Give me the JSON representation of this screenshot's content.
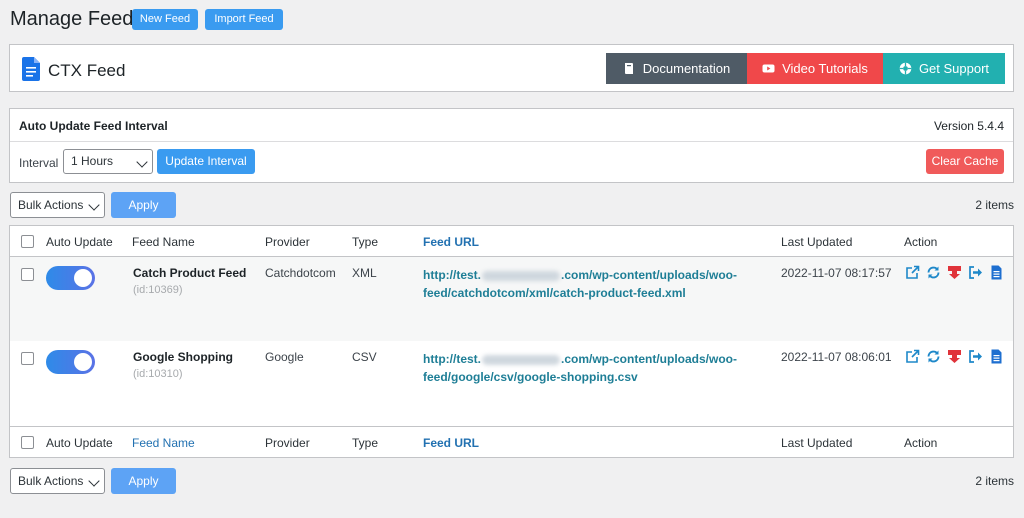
{
  "header": {
    "title": "Manage Feed",
    "new_feed": "New Feed",
    "import_feed": "Import Feed"
  },
  "brand": {
    "name": "CTX Feed",
    "documentation": "Documentation",
    "video_tutorials": "Video Tutorials",
    "get_support": "Get Support",
    "colors": {
      "documentation": "#4f5b66",
      "video": "#f0484a",
      "support": "#22b0b0"
    }
  },
  "auto_update": {
    "title": "Auto Update Feed Interval",
    "version": "Version 5.4.4",
    "interval_label": "Interval",
    "interval_value": "1 Hours",
    "update_button": "Update Interval",
    "clear_cache": "Clear Cache"
  },
  "bulk": {
    "select_value": "Bulk Actions",
    "apply": "Apply",
    "items_count": "2 items"
  },
  "table": {
    "columns": {
      "auto_update": "Auto Update",
      "feed_name": "Feed Name",
      "provider": "Provider",
      "type": "Type",
      "feed_url": "Feed URL",
      "last_updated": "Last Updated",
      "action": "Action"
    },
    "rows": [
      {
        "name": "Catch Product Feed",
        "id": "(id:10369)",
        "provider": "Catchdotcom",
        "type": "XML",
        "url_prefix": "http://test.",
        "url_rest_line1": ".com/wp-content/uploads/woo-",
        "url_line2": "feed/catchdotcom/xml/catch-product-feed.xml",
        "last_updated": "2022-11-07 08:17:57",
        "auto_update": true
      },
      {
        "name": "Google Shopping",
        "id": "(id:10310)",
        "provider": "Google",
        "type": "CSV",
        "url_prefix": "http://test.",
        "url_rest_line1": ".com/wp-content/uploads/woo-",
        "url_line2": "feed/google/csv/google-shopping.csv",
        "last_updated": "2022-11-07 08:06:01",
        "auto_update": true
      }
    ],
    "action_icons": [
      "external-link-icon",
      "refresh-icon",
      "download-icon",
      "export-icon",
      "document-icon"
    ]
  }
}
